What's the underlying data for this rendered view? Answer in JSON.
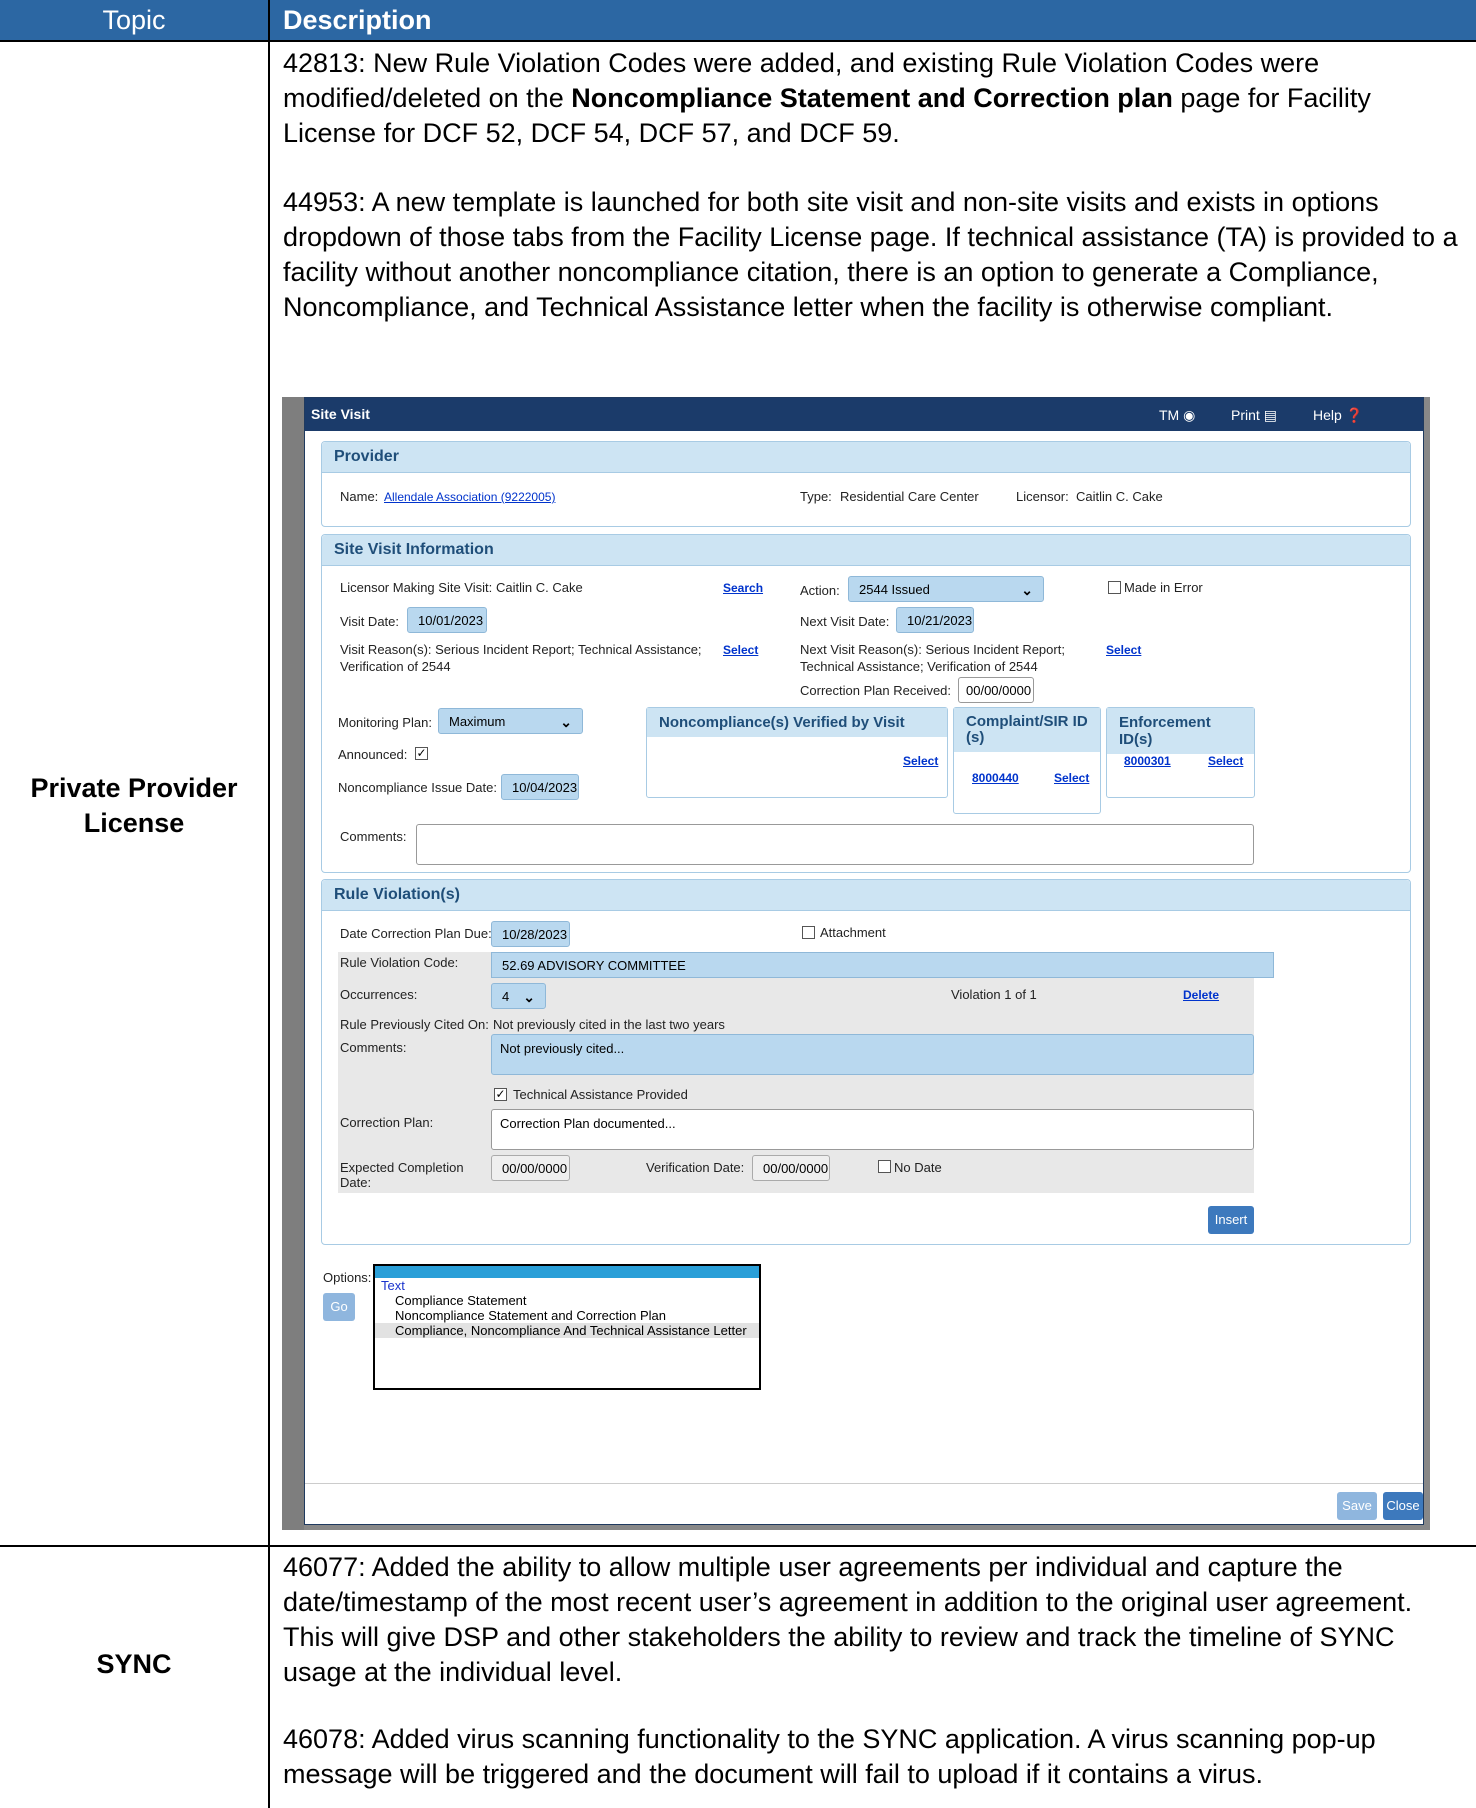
{
  "table": {
    "header_topic": "Topic",
    "header_description": "Description"
  },
  "rows": [
    {
      "topic_line1": "Private Provider",
      "topic_line2": "License",
      "para1_pre": "42813: New Rule Violation Codes were added, and existing Rule Violation Codes were modified/deleted on the ",
      "para1_bold": "Noncompliance Statement and Correction plan",
      "para1_post": " page for Facility License for DCF 52, DCF 54, DCF 57, and DCF 59.",
      "para2": "44953: A new template is launched for both site visit and non-site visits and exists in options dropdown of those tabs from the Facility License page. If technical assistance (TA) is provided to a facility without another noncompliance citation, there is an option to generate a Compliance, Noncompliance, and Technical Assistance letter when the facility is otherwise compliant."
    },
    {
      "topic": "SYNC",
      "para1": "46077: Added the ability to allow multiple user agreements per individual and capture the date/timestamp of the most recent user’s agreement in addition to the original user agreement. This will give DSP and other stakeholders the ability to review and track the timeline of SYNC usage at the individual level.",
      "para2": "46078: Added virus scanning functionality to the SYNC application. A virus scanning pop-up message will be triggered and the document will fail to upload if it contains a virus."
    }
  ],
  "dialog": {
    "title": "Site Visit",
    "tm": "TM",
    "print": "Print",
    "help": "Help",
    "provider": {
      "header": "Provider",
      "name_label": "Name:",
      "name_value": "Allendale Association (9222005)",
      "type_label": "Type:",
      "type_value": "Residential Care Center",
      "licensor_label": "Licensor:",
      "licensor_value": "Caitlin C. Cake"
    },
    "site_visit": {
      "header": "Site Visit Information",
      "licensor_label": "Licensor Making Site Visit:",
      "licensor_value": "Caitlin C. Cake",
      "search": "Search",
      "action_label": "Action:",
      "action_value": "2544 Issued",
      "made_in_error": "Made in Error",
      "visit_date_label": "Visit Date:",
      "visit_date": "10/01/2023",
      "next_visit_date_label": "Next Visit Date:",
      "next_visit_date": "10/21/2023",
      "visit_reasons_label": "Visit Reason(s):",
      "visit_reasons_l1": "Serious Incident Report; Technical Assistance;",
      "visit_reasons_l2": "Verification of 2544",
      "select": "Select",
      "next_reasons_label": "Next Visit Reason(s):",
      "next_reasons_l1": "Serious Incident Report;",
      "next_reasons_l2": "Technical Assistance; Verification of 2544",
      "correction_received_label": "Correction Plan Received:",
      "correction_received": "00/00/0000",
      "monitoring_label": "Monitoring Plan:",
      "monitoring_value": "Maximum",
      "announced_label": "Announced:",
      "nc_issue_label": "Noncompliance Issue Date:",
      "nc_issue_date": "10/04/2023",
      "nc_verified_header": "Noncompliance(s) Verified by Visit",
      "complaint_header_l1": "Complaint/SIR ID",
      "complaint_header_l2": "(s)",
      "complaint_id": "8000440",
      "enforcement_header": "Enforcement ID(s)",
      "enforcement_id": "8000301",
      "comments_label": "Comments:"
    },
    "rule": {
      "header": "Rule Violation(s)",
      "due_label": "Date Correction Plan Due:",
      "due_date": "10/28/2023",
      "attachment": "Attachment",
      "code_label": "Rule Violation Code:",
      "code_value": "52.69 ADVISORY COMMITTEE",
      "occurrences_label": "Occurrences:",
      "occurrences_value": "4",
      "violation_count": "Violation 1 of 1",
      "delete": "Delete",
      "prev_cited_label": "Rule Previously Cited On:",
      "prev_cited_value": "Not previously cited in the last two years",
      "comments_label": "Comments:",
      "comments_value": "Not previously cited...",
      "ta_provided": "Technical Assistance Provided",
      "correction_label": "Correction Plan:",
      "correction_value": "Correction Plan documented...",
      "expected_label_l1": "Expected Completion",
      "expected_label_l2": "Date:",
      "expected_value": "00/00/0000",
      "verification_label": "Verification Date:",
      "verification_value": "00/00/0000",
      "no_date": "No Date",
      "insert": "Insert"
    },
    "options": {
      "label": "Options:",
      "go": "Go",
      "group": "Text",
      "items": [
        "Compliance Statement",
        "Noncompliance Statement and Correction Plan",
        "Compliance, Noncompliance And Technical Assistance Letter"
      ]
    },
    "save": "Save",
    "close": "Close"
  }
}
